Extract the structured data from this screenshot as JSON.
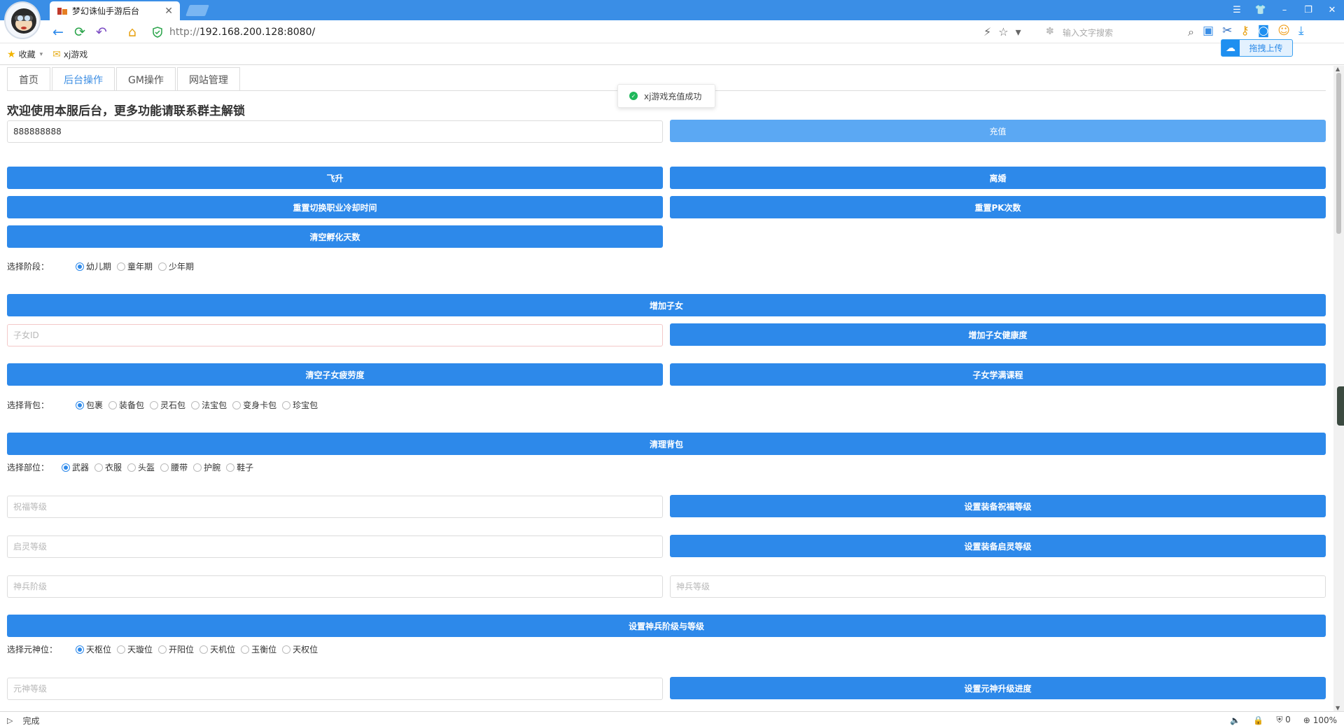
{
  "browser": {
    "tab_title": "梦幻诛仙手游后台",
    "tab_close": "✕",
    "url_proto": "http://",
    "url_host": "192.168.200.128:8080/",
    "search_placeholder": "输入文字搜索",
    "window_controls": [
      "☰",
      "👕",
      "–",
      "❐",
      "✕"
    ],
    "bookmarks": [
      {
        "label": "收藏",
        "icon": "star-icon"
      },
      {
        "label": "xj游戏",
        "icon": "folder-icon"
      }
    ],
    "upload_label": "拖拽上传",
    "status_text": "完成",
    "download_count": "0",
    "zoom": "100%"
  },
  "page": {
    "tabs": [
      {
        "label": "首页",
        "active": false
      },
      {
        "label": "后台操作",
        "active": true
      },
      {
        "label": "GM操作",
        "active": false
      },
      {
        "label": "网站管理",
        "active": false
      }
    ],
    "toast": "xj游戏充值成功",
    "welcome": "欢迎使用本服后台，更多功能请联系群主解锁",
    "recharge": {
      "value": "888888888",
      "button": "充值"
    },
    "buttons": {
      "ascend": "飞升",
      "divorce": "离婚",
      "reset_job_cd": "重置切换职业冷却时间",
      "reset_pk": "重置PK次数",
      "clear_hatch": "清空孵化天数",
      "add_child": "增加子女",
      "add_child_health": "增加子女健康度",
      "clear_child_fatigue": "清空子女疲劳度",
      "child_full_course": "子女学满课程",
      "clear_bag": "清理背包",
      "set_bless": "设置装备祝福等级",
      "set_spirit": "设置装备启灵等级",
      "set_weapon": "设置神兵阶级与等级",
      "set_yuanshen": "设置元神升级进度"
    },
    "stage": {
      "label": "选择阶段：",
      "options": [
        "幼儿期",
        "童年期",
        "少年期"
      ],
      "selected": 0
    },
    "child_id_placeholder": "子女ID",
    "bag": {
      "label": "选择背包：",
      "options": [
        "包裹",
        "装备包",
        "灵石包",
        "法宝包",
        "变身卡包",
        "珍宝包"
      ],
      "selected": 0
    },
    "part": {
      "label": "选择部位：",
      "options": [
        "武器",
        "衣服",
        "头盔",
        "腰带",
        "护腕",
        "鞋子"
      ],
      "selected": 0
    },
    "bless_placeholder": "祝福等级",
    "spirit_placeholder": "启灵等级",
    "weapon_rank_placeholder": "神兵阶级",
    "weapon_level_placeholder": "神兵等级",
    "yuanshen": {
      "label": "选择元神位：",
      "options": [
        "天枢位",
        "天璇位",
        "开阳位",
        "天机位",
        "玉衡位",
        "天权位"
      ],
      "selected": 0
    },
    "yuanshen_level_placeholder": "元神等级"
  },
  "colors": {
    "primary": "#2d89ea",
    "titlebar": "#3a8ee6",
    "success": "#1fb85b"
  }
}
